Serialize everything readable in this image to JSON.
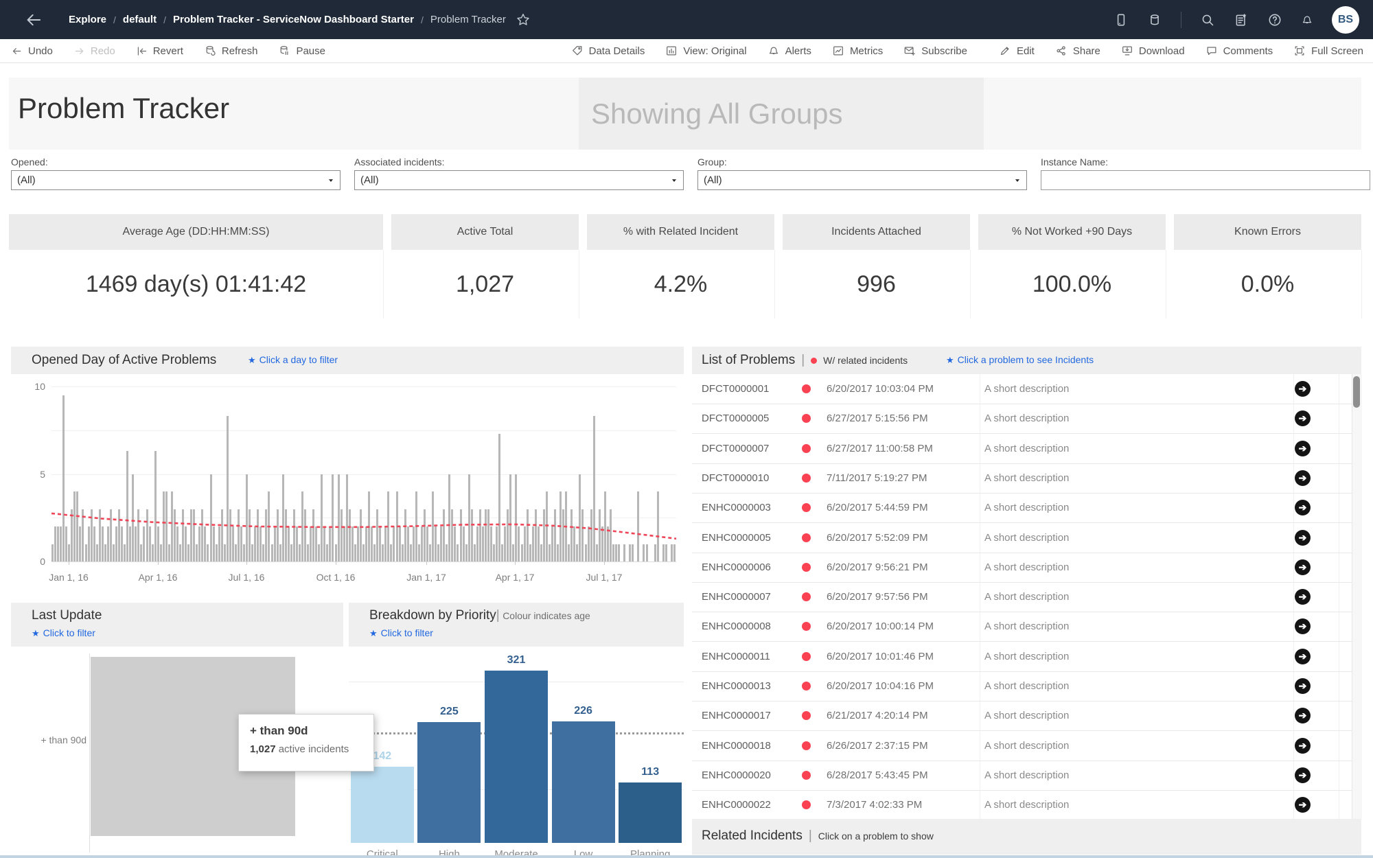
{
  "navbar": {
    "breadcrumb": [
      "Explore",
      "default",
      "Problem Tracker - ServiceNow Dashboard Starter",
      "Problem Tracker"
    ],
    "avatar_initials": "BS",
    "right_icons": [
      "device-icon",
      "data-source-icon",
      "search-icon",
      "favorites-list-icon",
      "help-icon",
      "notifications-icon"
    ]
  },
  "toolbar": {
    "left": [
      {
        "icon": "undo",
        "label": "Undo",
        "disabled": false
      },
      {
        "icon": "redo",
        "label": "Redo",
        "disabled": true
      },
      {
        "icon": "revert",
        "label": "Revert",
        "disabled": false
      },
      {
        "icon": "refresh",
        "label": "Refresh",
        "disabled": false
      },
      {
        "icon": "pause",
        "label": "Pause",
        "disabled": false
      }
    ],
    "right": [
      {
        "icon": "tag",
        "label": "Data Details"
      },
      {
        "icon": "view",
        "label": "View: Original"
      },
      {
        "icon": "bell",
        "label": "Alerts"
      },
      {
        "icon": "metrics",
        "label": "Metrics"
      },
      {
        "icon": "subscribe",
        "label": "Subscribe"
      },
      {
        "icon": "pencil",
        "label": "Edit"
      },
      {
        "icon": "share",
        "label": "Share"
      },
      {
        "icon": "download",
        "label": "Download"
      },
      {
        "icon": "comment",
        "label": "Comments"
      },
      {
        "icon": "fullscreen",
        "label": "Full Screen"
      }
    ]
  },
  "title": {
    "main": "Problem Tracker",
    "showing": "Showing All Groups"
  },
  "filters": [
    {
      "label": "Opened:",
      "value": "(All)",
      "type": "dropdown"
    },
    {
      "label": "Associated incidents:",
      "value": "(All)",
      "type": "dropdown"
    },
    {
      "label": "Group:",
      "value": "(All)",
      "type": "dropdown"
    },
    {
      "label": "Instance Name:",
      "value": "",
      "type": "input"
    }
  ],
  "kpis": [
    {
      "label": "Average Age (DD:HH:MM:SS)",
      "value": "1469 day(s) 01:41:42"
    },
    {
      "label": "Active Total",
      "value": "1,027"
    },
    {
      "label": "% with Related Incident",
      "value": "4.2%"
    },
    {
      "label": "Incidents Attached",
      "value": "996"
    },
    {
      "label": "% Not Worked +90 Days",
      "value": "100.0%"
    },
    {
      "label": "Known Errors",
      "value": "0.0%"
    }
  ],
  "panels": {
    "opened_day": {
      "title": "Opened Day of Active Problems",
      "link": "Click a day to filter"
    },
    "last_update": {
      "title": "Last Update",
      "link": "Click to filter"
    },
    "priority": {
      "title": "Breakdown by Priority",
      "subtitle": "Colour indicates age",
      "link": "Click to filter"
    },
    "list": {
      "title": "List of Problems",
      "legend": "W/ related incidents",
      "link": "Click a problem to see Incidents"
    },
    "related": {
      "title": "Related Incidents",
      "subtitle": "Click on a problem to show"
    }
  },
  "chart_data": [
    {
      "id": "opened_day",
      "type": "bar",
      "title": "Opened Day of Active Problems",
      "ylabel": "",
      "xlabel": "",
      "ylim": [
        0,
        10
      ],
      "y_ticks": [
        10,
        5,
        0
      ],
      "x_axis_labels": [
        "Jan 1, 16",
        "Apr 1, 16",
        "Jul 1, 16",
        "Oct 1, 16",
        "Jan 1, 17",
        "Apr 1, 17",
        "Jul 1, 17"
      ],
      "x_label_fracs": [
        0.027,
        0.17,
        0.312,
        0.455,
        0.6,
        0.742,
        0.885
      ],
      "bar_color": "#b7b7b7",
      "trend_color": "#ee4557",
      "bar_values": [
        1,
        2,
        2,
        2,
        9.5,
        2,
        1,
        3,
        4,
        4,
        2,
        3,
        1,
        2,
        3,
        2,
        1,
        3,
        2,
        1,
        2,
        3,
        1,
        2,
        3,
        2,
        1,
        6.3,
        2,
        5,
        2,
        3,
        1,
        2,
        3,
        2,
        1,
        6.3,
        2,
        1,
        4,
        4,
        1,
        4,
        3,
        2,
        1,
        3,
        2,
        1,
        3,
        3,
        1,
        2,
        3,
        2,
        1,
        5,
        2,
        1,
        2,
        3,
        1,
        8.3,
        3,
        2,
        1,
        3,
        2,
        1,
        5,
        3,
        1,
        2,
        3,
        2,
        1,
        3,
        4,
        1,
        2,
        3,
        1,
        5,
        3,
        2,
        1,
        3,
        2,
        1,
        4,
        3,
        1,
        2,
        3,
        2,
        1,
        5,
        2,
        1,
        2,
        5,
        1,
        5,
        3,
        2,
        5,
        3,
        2,
        1,
        2,
        3,
        1,
        2,
        4,
        2,
        1,
        3,
        2,
        1,
        2,
        4,
        1,
        2,
        4,
        2,
        1,
        3,
        2,
        1,
        2,
        4,
        1,
        2,
        3,
        2,
        1,
        4,
        2,
        1,
        2,
        3,
        1,
        5,
        3,
        2,
        1,
        3,
        2,
        1,
        5,
        3,
        1,
        2,
        3,
        2,
        3,
        3,
        2,
        1,
        2,
        7.3,
        1,
        2,
        3,
        5,
        1,
        5,
        2,
        1,
        2,
        3,
        1,
        2,
        3,
        2,
        1,
        3,
        4,
        1,
        2,
        3,
        1,
        4,
        3,
        4,
        1,
        3,
        2,
        1,
        5,
        3,
        1,
        2,
        3,
        8.3,
        1,
        3,
        2,
        4,
        2,
        3,
        1,
        1,
        1,
        0,
        1,
        0,
        1,
        1,
        0,
        4,
        0,
        1,
        1,
        0,
        0,
        1,
        4,
        0,
        1,
        1,
        0,
        1,
        1
      ],
      "trend_points": [
        [
          0,
          2.75
        ],
        [
          0.08,
          2.45
        ],
        [
          0.16,
          2.25
        ],
        [
          0.25,
          2.1
        ],
        [
          0.33,
          2.0
        ],
        [
          0.42,
          1.97
        ],
        [
          0.5,
          1.97
        ],
        [
          0.58,
          2.02
        ],
        [
          0.66,
          2.1
        ],
        [
          0.74,
          2.12
        ],
        [
          0.8,
          2.05
        ],
        [
          0.86,
          1.9
        ],
        [
          0.92,
          1.65
        ],
        [
          1,
          1.3
        ]
      ]
    },
    {
      "id": "last_update",
      "type": "bar",
      "categories": [
        "+ than 90d"
      ],
      "values": [
        1027
      ],
      "bar_color": "#cecece",
      "tooltip": {
        "title": "+ than 90d",
        "bold": "1,027",
        "rest": " active incidents"
      }
    },
    {
      "id": "priority",
      "type": "bar",
      "title": "Breakdown by Priority",
      "categories": [
        "Critical",
        "High",
        "Moderate",
        "Low",
        "Planning"
      ],
      "values": [
        142,
        225,
        321,
        226,
        113
      ],
      "colors": [
        "#b9dbef",
        "#3f6fa0",
        "#33689a",
        "#3f6fa0",
        "#2d5f8b"
      ],
      "label_colors": [
        "#aed4ea",
        "#33608f",
        "#33608f",
        "#33608f",
        "#33608f"
      ],
      "average": 205.4,
      "ylim": [
        0,
        340
      ],
      "gridlines": [
        100,
        300
      ]
    }
  ],
  "list_rows": [
    {
      "id": "DFCT0000001",
      "time": "6/20/2017 10:03:04 PM",
      "desc": "A short description"
    },
    {
      "id": "DFCT0000005",
      "time": "6/27/2017 5:15:56 PM",
      "desc": "A short description"
    },
    {
      "id": "DFCT0000007",
      "time": "6/27/2017 11:00:58 PM",
      "desc": "A short description"
    },
    {
      "id": "DFCT0000010",
      "time": "7/11/2017 5:19:27 PM",
      "desc": "A short description"
    },
    {
      "id": "ENHC0000003",
      "time": "6/20/2017 5:44:59 PM",
      "desc": "A short description"
    },
    {
      "id": "ENHC0000005",
      "time": "6/20/2017 5:52:09 PM",
      "desc": "A short description"
    },
    {
      "id": "ENHC0000006",
      "time": "6/20/2017 9:56:21 PM",
      "desc": "A short description"
    },
    {
      "id": "ENHC0000007",
      "time": "6/20/2017 9:57:56 PM",
      "desc": "A short description"
    },
    {
      "id": "ENHC0000008",
      "time": "6/20/2017 10:00:14 PM",
      "desc": "A short description"
    },
    {
      "id": "ENHC0000011",
      "time": "6/20/2017 10:01:46 PM",
      "desc": "A short description"
    },
    {
      "id": "ENHC0000013",
      "time": "6/20/2017 10:04:16 PM",
      "desc": "A short description"
    },
    {
      "id": "ENHC0000017",
      "time": "6/21/2017 4:20:14 PM",
      "desc": "A short description"
    },
    {
      "id": "ENHC0000018",
      "time": "6/26/2017 2:37:15 PM",
      "desc": "A short description"
    },
    {
      "id": "ENHC0000020",
      "time": "6/28/2017 5:43:45 PM",
      "desc": "A short description"
    },
    {
      "id": "ENHC0000022",
      "time": "7/3/2017 4:02:33 PM",
      "desc": "A short description"
    }
  ],
  "colors": {
    "navbar_bg": "#1f2937",
    "link_blue": "#2268e0",
    "red_dot": "#fa4252",
    "trend_red": "#ee4557",
    "panel_header_bg": "#efefef"
  }
}
